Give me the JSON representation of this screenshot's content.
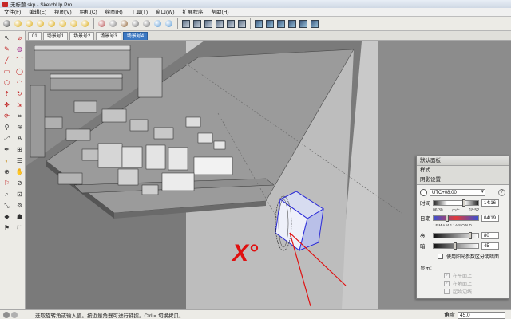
{
  "window": {
    "title": "无标题.skp - SketchUp Pro"
  },
  "menu": [
    "文件(F)",
    "编辑(E)",
    "视图(V)",
    "相机(C)",
    "绘图(R)",
    "工具(T)",
    "窗口(W)",
    "扩展程序",
    "帮助(H)"
  ],
  "toolbar": {
    "icons": [
      "select-tool-icon",
      "push-pull-icon",
      "rotate-icon",
      "follow-me-icon",
      "move-icon",
      "offset-icon",
      "scale-icon",
      "paint-icon",
      "components-icon",
      "orbit-icon",
      "pan-icon",
      "zoom-icon",
      "zoom-extents-icon",
      "previous-view-icon",
      "next-view-icon",
      "iso-view-icon",
      "top-view-icon",
      "front-view-icon",
      "right-view-icon",
      "back-view-icon",
      "left-view-icon",
      "xray-icon",
      "wireframe-icon",
      "hidden-line-icon",
      "shaded-icon",
      "textured-icon",
      "monochrome-icon"
    ]
  },
  "scene_tabs": [
    {
      "label": "01",
      "active": false
    },
    {
      "label": "场景号1",
      "active": false
    },
    {
      "label": "场景号2",
      "active": false
    },
    {
      "label": "场景号3",
      "active": false
    },
    {
      "label": "场景号4",
      "active": true
    }
  ],
  "palette": [
    "↖",
    "⌀",
    "✎",
    "◍",
    "╱",
    "⌒",
    "▭",
    "◯",
    "⬡",
    "◠",
    "⇡",
    "↻",
    "✥",
    "⇲",
    "⟳",
    "⌗",
    "⚲",
    "≋",
    "⤢",
    "A",
    "✒",
    "⊞",
    "◐",
    "☰",
    "⊕",
    "✋",
    "⚐",
    "⊘",
    "⌕",
    "⊡",
    "⤡",
    "⊚",
    "◆",
    "☗",
    "⚑",
    "⬚"
  ],
  "tray": {
    "header": "默认面板",
    "sub": "样式",
    "section": "阴影设置",
    "timezone": "UTC+08:00",
    "time_label": "时间",
    "time_value": "14:16",
    "time_ticks": [
      "06:30",
      "中午",
      "18:52"
    ],
    "date_label": "日期",
    "date_value": "04/19",
    "month_letters": "J F M A M J J A S O N D",
    "light_label": "亮",
    "light_value": "80",
    "dark_label": "暗",
    "dark_value": "45",
    "use_sun": "使用阳光参数区分明暗面",
    "display_label": "显示:",
    "on_faces": "在平面上",
    "on_ground": "在地面上",
    "from_edges": "起始边线"
  },
  "viewport": {
    "annotation": "X°"
  },
  "status": {
    "message": "选取旋转角或输入值。按近量角器可进行捕捉。Ctrl = 切换拷贝。",
    "vcb_label": "角度",
    "vcb_value": "45.0"
  }
}
